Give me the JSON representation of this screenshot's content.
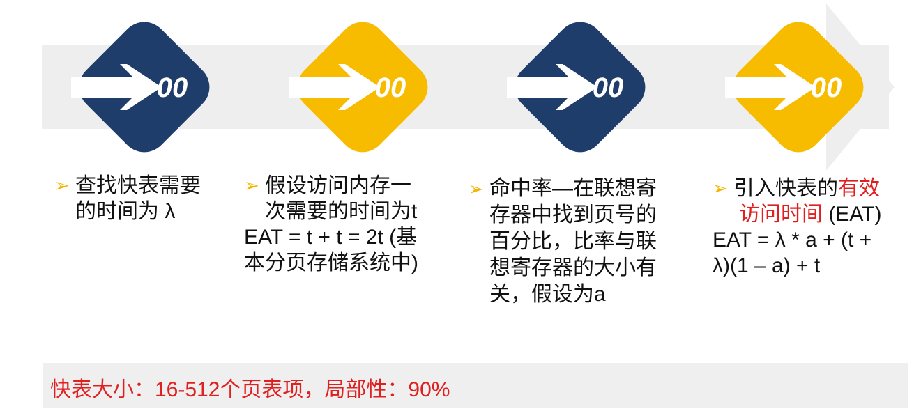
{
  "colors": {
    "navy": "#1f3d6a",
    "gold": "#f7bc00",
    "band": "#eeeeee",
    "bullet": "#f4b400",
    "highlight": "#e02020"
  },
  "steps": [
    {
      "number": "00",
      "color": "navy",
      "icon": "arrow-right-icon",
      "lines": [
        {
          "bullet": "➢",
          "parts": [
            {
              "text": "查找快表需要",
              "highlight": false
            }
          ]
        },
        {
          "parts": [
            {
              "text": "的时间为 λ",
              "highlight": false
            }
          ]
        }
      ]
    },
    {
      "number": "00",
      "color": "gold",
      "icon": "arrow-right-icon",
      "lines": [
        {
          "bullet": "➢",
          "parts": [
            {
              "text": "假设访问内存一",
              "highlight": false
            }
          ]
        },
        {
          "parts": [
            {
              "text": "次需要的时间为t",
              "highlight": false
            }
          ]
        },
        {
          "parts": [
            {
              "text": "EAT = t + t = 2t (基",
              "highlight": false
            }
          ]
        },
        {
          "parts": [
            {
              "text": "本分页存储系统中)",
              "highlight": false
            }
          ]
        }
      ]
    },
    {
      "number": "00",
      "color": "navy",
      "icon": "arrow-right-icon",
      "lines": [
        {
          "bullet": "➢",
          "parts": [
            {
              "text": "命中率—在联想寄",
              "highlight": false
            }
          ]
        },
        {
          "parts": [
            {
              "text": "存器中找到页号的",
              "highlight": false
            }
          ]
        },
        {
          "parts": [
            {
              "text": "百分比，比率与联",
              "highlight": false
            }
          ]
        },
        {
          "parts": [
            {
              "text": "想寄存器的大小有",
              "highlight": false
            }
          ]
        },
        {
          "parts": [
            {
              "text": "关，假设为a",
              "highlight": false
            }
          ]
        }
      ]
    },
    {
      "number": "00",
      "color": "gold",
      "icon": "arrow-right-icon",
      "lines": [
        {
          "bullet": "➢",
          "parts": [
            {
              "text": "引入快表的",
              "highlight": false
            },
            {
              "text": "有效",
              "highlight": true
            }
          ]
        },
        {
          "parts": [
            {
              "text": "访问时间",
              "highlight": true
            },
            {
              "text": " (EAT)",
              "highlight": false
            }
          ]
        },
        {
          "parts": [
            {
              "text": "EAT = λ * a + (t +",
              "highlight": false
            }
          ]
        },
        {
          "parts": [
            {
              "text": "λ)(1 – a) +  t",
              "highlight": false
            }
          ]
        }
      ]
    }
  ],
  "footer": "快表大小：16-512个页表项，局部性：90%"
}
